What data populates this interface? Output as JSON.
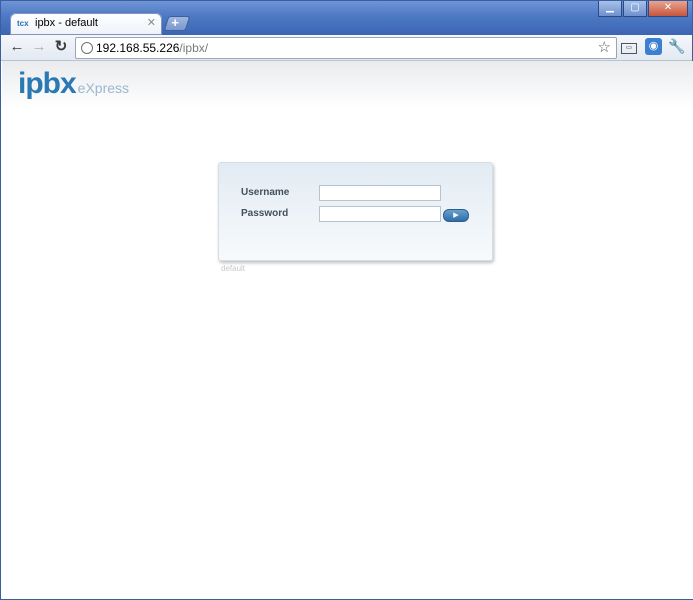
{
  "browser": {
    "tab_title": "ipbx - default",
    "tab_favicon": "tcx",
    "url_host": "192.168.55.226",
    "url_path": "/ipbx/"
  },
  "page": {
    "logo_main": "ipbx",
    "logo_sub": "eXpress",
    "login": {
      "username_label": "Username",
      "username_value": "",
      "password_label": "Password",
      "password_value": ""
    },
    "footer_caption": "default"
  },
  "colors": {
    "accent": "#2a79b3",
    "titlebar": "#4d78c4"
  },
  "icons": {
    "back": "back-arrow-icon",
    "forward": "forward-arrow-icon",
    "reload": "reload-icon",
    "star": "bookmark-star-icon",
    "page_menu": "page-menu-icon",
    "extension": "extension-icon",
    "wrench": "wrench-icon"
  }
}
